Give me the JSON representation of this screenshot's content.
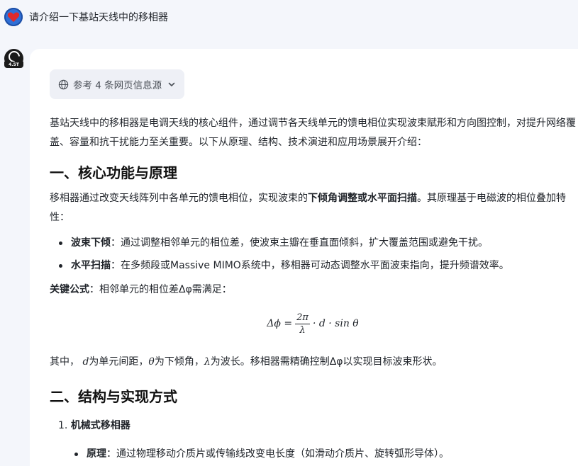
{
  "user": {
    "question": "请介绍一下基站天线中的移相器"
  },
  "bot": {
    "badge": "4.5T"
  },
  "sources": {
    "label": "参考 4 条网页信息源"
  },
  "answer": {
    "intro": "基站天线中的移相器是电调天线的核心组件，通过调节各天线单元的馈电相位实现波束赋形和方向图控制，对提升网络覆盖、容量和抗干扰能力至关重要。以下从原理、结构、技术演进和应用场景展开介绍：",
    "section1_title": "一、核心功能与原理",
    "s1_para_a": "移相器通过改变天线阵列中各单元的馈电相位，实现波束的",
    "s1_bold1": "下倾角调整",
    "s1_or": "或",
    "s1_bold2": "水平面扫描",
    "s1_para_b": "。其原理基于电磁波的相位叠加特性：",
    "bullet1_term": "波束下倾",
    "bullet1_text": "：通过调整相邻单元的相位差，使波束主瓣在垂直面倾斜，扩大覆盖范围或避免干扰。",
    "bullet2_term": "水平扫描",
    "bullet2_text": "：在多频段或Massive MIMO系统中，移相器可动态调整水平面波束指向，提升频谱效率。",
    "key_term": "关键公式",
    "key_text": "：相邻单元的相位差Δφ需满足：",
    "formula_lhs": "Δϕ =",
    "formula_num": "2π",
    "formula_den": "λ",
    "formula_rhs": "· d · sin θ",
    "where_prefix": "其中，",
    "var_d": "d",
    "where_d": "为单元间距，",
    "var_theta": "θ",
    "where_theta": "为下倾角，",
    "var_lambda": "λ",
    "where_lambda": "为波长。移相器需精确控制Δφ以实现目标波束形状。",
    "section2_title": "二、结构与实现方式",
    "list1_num": "1.",
    "list1_title": "机械式移相器",
    "sub1_term": "原理",
    "sub1_text": "：通过物理移动介质片或传输线改变电长度（如滑动介质片、旋转弧形导体）。"
  }
}
